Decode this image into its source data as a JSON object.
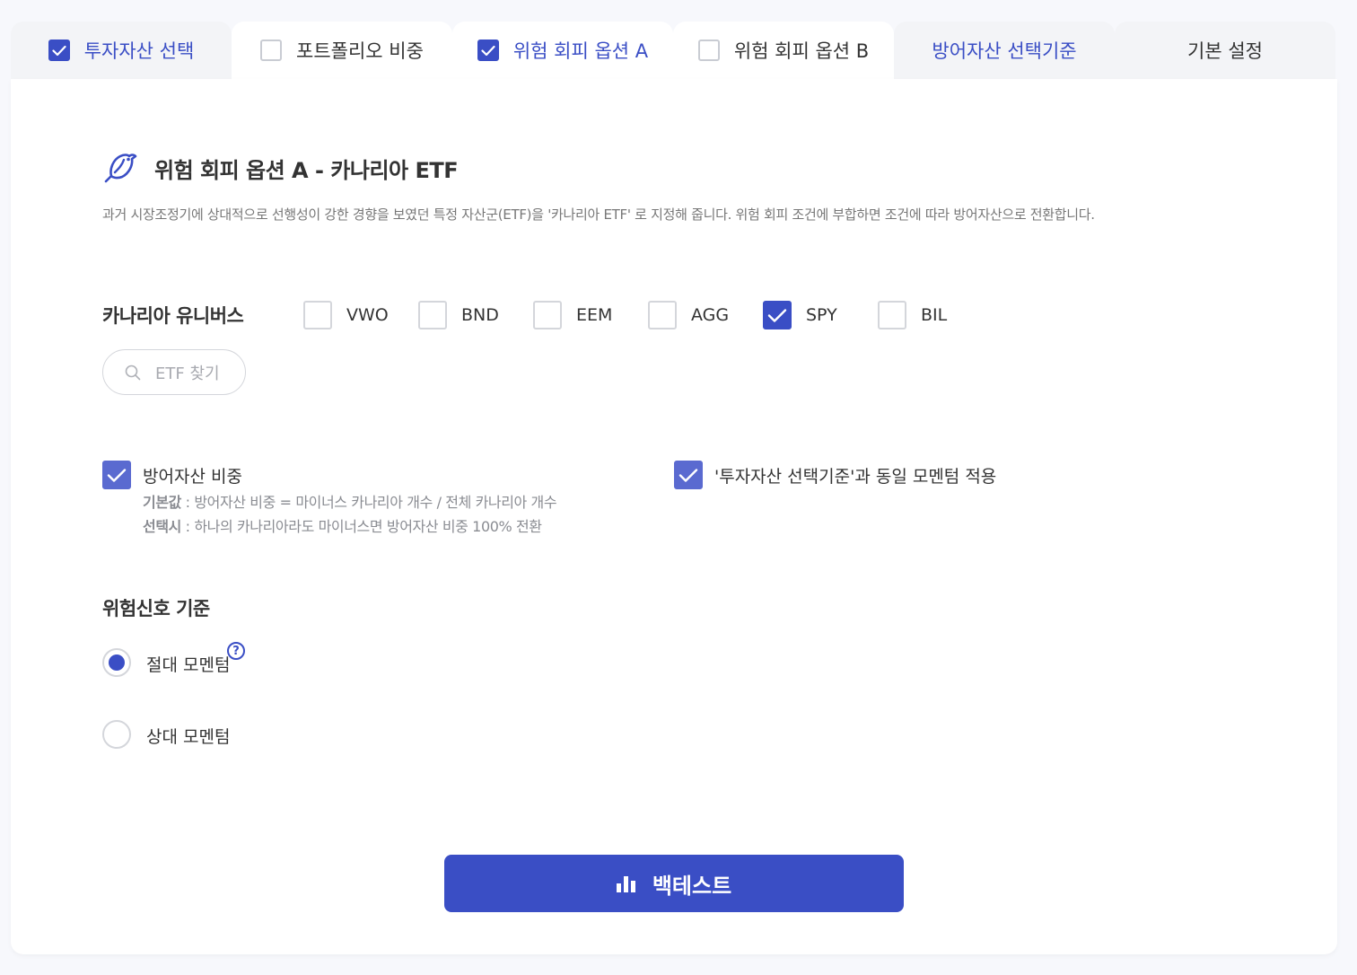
{
  "tabs": [
    {
      "label": "투자자산 선택",
      "checkbox": true,
      "checked": true,
      "active": false,
      "highlight": true
    },
    {
      "label": "포트폴리오 비중",
      "checkbox": true,
      "checked": false,
      "active": true,
      "highlight": false
    },
    {
      "label": "위험 회피 옵션 A",
      "checkbox": true,
      "checked": true,
      "active": true,
      "highlight": true
    },
    {
      "label": "위험 회피 옵션 B",
      "checkbox": true,
      "checked": false,
      "active": true,
      "highlight": false
    },
    {
      "label": "방어자산 선택기준",
      "checkbox": false,
      "checked": false,
      "active": false,
      "highlight": true
    },
    {
      "label": "기본 설정",
      "checkbox": false,
      "checked": false,
      "active": false,
      "highlight": false
    }
  ],
  "section": {
    "title": "위험 회피 옵션 A - 카나리아 ETF",
    "icon": "bird-icon",
    "description": "과거 시장조정기에 상대적으로 선행성이 강한 경향을 보였던 특정 자산군(ETF)을 '카나리아 ETF' 로 지정해 줍니다. 위험 회피 조건에 부합하면 조건에 따라 방어자산으로 전환합니다."
  },
  "canary": {
    "label": "카나리아 유니버스",
    "etfs": [
      {
        "ticker": "VWO",
        "checked": false
      },
      {
        "ticker": "BND",
        "checked": false
      },
      {
        "ticker": "EEM",
        "checked": false
      },
      {
        "ticker": "AGG",
        "checked": false
      },
      {
        "ticker": "SPY",
        "checked": true
      },
      {
        "ticker": "BIL",
        "checked": false
      }
    ],
    "search_placeholder": "ETF 찾기"
  },
  "options": {
    "defense_weight": {
      "label": "방어자산 비중",
      "checked": true,
      "default_key": "기본값",
      "default_text": " : 방어자산 비중 = 마이너스 카나리아 개수 / 전체 카나리아 개수",
      "selected_key": "선택시",
      "selected_text": " : 하나의 카나리아라도 마이너스면 방어자산 비중 100% 전환"
    },
    "same_momentum": {
      "label": "'투자자산 선택기준'과 동일 모멘텀 적용",
      "checked": true
    }
  },
  "risk_signal": {
    "title": "위험신호 기준",
    "choices": [
      {
        "label": "절대 모멘텀",
        "selected": true,
        "help": "?"
      },
      {
        "label": "상대 모멘텀",
        "selected": false
      }
    ]
  },
  "backtest_button": {
    "label": "백테스트"
  },
  "colors": {
    "accent": "#3a4ec5",
    "tab_inactive": "#f3f4f7",
    "background": "#f7f8fc"
  }
}
